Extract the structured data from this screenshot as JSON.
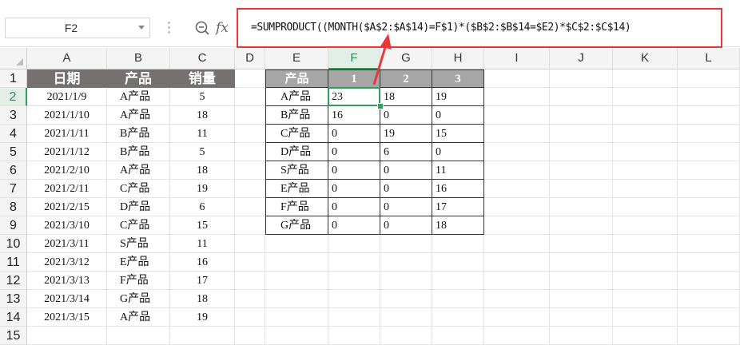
{
  "name_box": {
    "value": "F2"
  },
  "formula_bar": {
    "fx_label": "fx",
    "formula": "=SUMPRODUCT((MONTH($A$2:$A$14)=F$1)*($B$2:$B$14=$E2)*$C$2:$C$14)"
  },
  "columns": [
    "A",
    "B",
    "C",
    "D",
    "E",
    "F",
    "G",
    "H",
    "I",
    "J",
    "K",
    "L"
  ],
  "rows": [
    "1",
    "2",
    "3",
    "4",
    "5",
    "6",
    "7",
    "8",
    "9",
    "10",
    "11",
    "12",
    "13",
    "14",
    "15"
  ],
  "source_table": {
    "headers": [
      "日期",
      "产品",
      "销量"
    ],
    "rows": [
      [
        "2021/1/9",
        "A产品",
        "5"
      ],
      [
        "2021/1/10",
        "A产品",
        "18"
      ],
      [
        "2021/1/11",
        "B产品",
        "11"
      ],
      [
        "2021/1/12",
        "B产品",
        "5"
      ],
      [
        "2021/2/10",
        "A产品",
        "18"
      ],
      [
        "2021/2/11",
        "C产品",
        "19"
      ],
      [
        "2021/2/15",
        "D产品",
        "6"
      ],
      [
        "2021/3/10",
        "C产品",
        "15"
      ],
      [
        "2021/3/11",
        "S产品",
        "11"
      ],
      [
        "2021/3/12",
        "E产品",
        "16"
      ],
      [
        "2021/3/13",
        "F产品",
        "17"
      ],
      [
        "2021/3/14",
        "G产品",
        "18"
      ],
      [
        "2021/3/15",
        "A产品",
        "19"
      ]
    ]
  },
  "summary_table": {
    "corner_header": "产品",
    "month_headers": [
      "1",
      "2",
      "3"
    ],
    "rows": [
      {
        "product": "A产品",
        "values": [
          "23",
          "18",
          "19"
        ]
      },
      {
        "product": "B产品",
        "values": [
          "16",
          "0",
          "0"
        ]
      },
      {
        "product": "C产品",
        "values": [
          "0",
          "19",
          "15"
        ]
      },
      {
        "product": "D产品",
        "values": [
          "0",
          "6",
          "0"
        ]
      },
      {
        "product": "S产品",
        "values": [
          "0",
          "0",
          "11"
        ]
      },
      {
        "product": "E产品",
        "values": [
          "0",
          "0",
          "16"
        ]
      },
      {
        "product": "F产品",
        "values": [
          "0",
          "0",
          "17"
        ]
      },
      {
        "product": "G产品",
        "values": [
          "0",
          "0",
          "18"
        ]
      }
    ]
  },
  "selection": {
    "column": "F",
    "row": "2"
  },
  "colors": {
    "header_dark": "#767171",
    "header_grey": "#a6a6a6",
    "selection_green": "#2e9e5b",
    "callout_red": "#e8383b"
  }
}
